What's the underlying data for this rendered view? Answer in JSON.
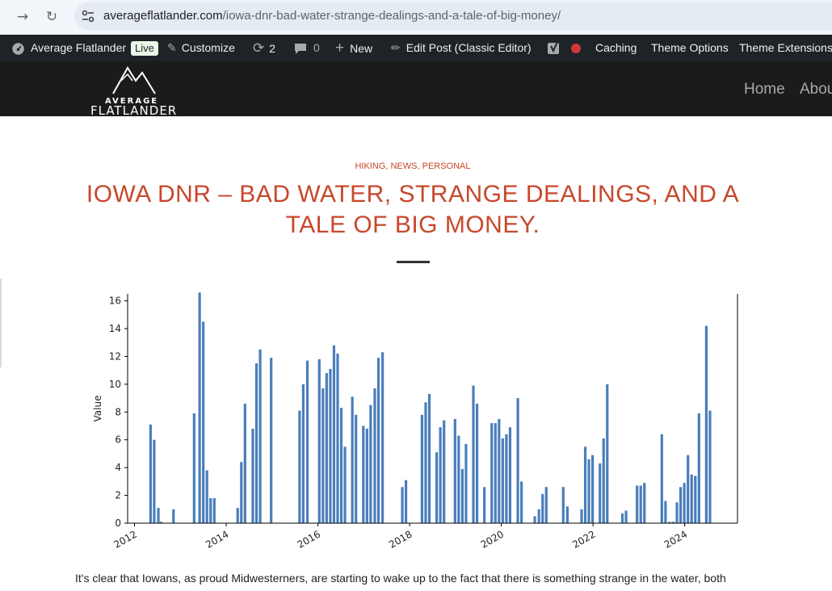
{
  "browser": {
    "url_domain": "averageflatlander.com",
    "url_path": "/iowa-dnr-bad-water-strange-dealings-and-a-tale-of-big-money/"
  },
  "adminbar": {
    "site_name": "Average Flatlander",
    "live_label": "Live",
    "customize": "Customize",
    "updates_count": "2",
    "comments_count": "0",
    "new_label": "New",
    "edit_post": "Edit Post (Classic Editor)",
    "caching": "Caching",
    "theme_options": "Theme Options",
    "theme_extensions": "Theme Extensions"
  },
  "site": {
    "logo_top": "AVERAGE",
    "logo_bottom": "FLATLANDER",
    "nav": [
      "Home",
      "About"
    ]
  },
  "article": {
    "categories": "Hiking, News, Personal",
    "title": "Iowa DNR – Bad Water, Strange Dealings, and a Tale of Big Money.",
    "body_excerpt": "It's clear that Iowans, as proud Midwesterners, are starting to wake up to the fact that there is something strange in the water, both physically and"
  },
  "colors": {
    "accent": "#c8472b",
    "bar": "#4a7ebb",
    "adminbar": "#1d2327",
    "header": "#1b1b1b"
  },
  "chart_data": {
    "type": "bar",
    "ylabel": "Value",
    "xlabel": "",
    "ylim": [
      0,
      16.5
    ],
    "xlim": [
      2011.85,
      2025.15
    ],
    "x_ticks": [
      "2012",
      "2014",
      "2016",
      "2018",
      "2020",
      "2022",
      "2024"
    ],
    "y_ticks": [
      "0",
      "2",
      "4",
      "6",
      "8",
      "10",
      "12",
      "14",
      "16"
    ],
    "bars": [
      [
        2012.35,
        7.1
      ],
      [
        2012.43,
        6.0
      ],
      [
        2012.52,
        1.1
      ],
      [
        2012.58,
        0.1
      ],
      [
        2012.85,
        1.0
      ],
      [
        2013.3,
        7.9
      ],
      [
        2013.42,
        16.6
      ],
      [
        2013.5,
        14.5
      ],
      [
        2013.58,
        3.8
      ],
      [
        2013.66,
        1.8
      ],
      [
        2013.74,
        1.8
      ],
      [
        2014.25,
        1.1
      ],
      [
        2014.33,
        4.4
      ],
      [
        2014.41,
        8.6
      ],
      [
        2014.58,
        6.8
      ],
      [
        2014.66,
        11.5
      ],
      [
        2014.74,
        12.5
      ],
      [
        2014.98,
        11.9
      ],
      [
        2015.6,
        8.1
      ],
      [
        2015.68,
        10.0
      ],
      [
        2015.77,
        11.7
      ],
      [
        2016.03,
        11.8
      ],
      [
        2016.11,
        9.7
      ],
      [
        2016.19,
        10.8
      ],
      [
        2016.27,
        11.1
      ],
      [
        2016.35,
        12.8
      ],
      [
        2016.43,
        12.2
      ],
      [
        2016.51,
        8.3
      ],
      [
        2016.59,
        5.5
      ],
      [
        2016.75,
        9.1
      ],
      [
        2016.83,
        7.8
      ],
      [
        2016.99,
        7.0
      ],
      [
        2017.07,
        6.8
      ],
      [
        2017.15,
        8.5
      ],
      [
        2017.24,
        9.7
      ],
      [
        2017.32,
        11.9
      ],
      [
        2017.41,
        12.3
      ],
      [
        2017.84,
        2.6
      ],
      [
        2017.92,
        3.1
      ],
      [
        2018.27,
        7.8
      ],
      [
        2018.35,
        8.7
      ],
      [
        2018.43,
        9.3
      ],
      [
        2018.59,
        5.1
      ],
      [
        2018.67,
        6.9
      ],
      [
        2018.75,
        7.4
      ],
      [
        2018.99,
        7.5
      ],
      [
        2019.07,
        6.3
      ],
      [
        2019.15,
        3.9
      ],
      [
        2019.23,
        5.7
      ],
      [
        2019.39,
        9.9
      ],
      [
        2019.47,
        8.6
      ],
      [
        2019.63,
        2.6
      ],
      [
        2019.79,
        7.2
      ],
      [
        2019.87,
        7.2
      ],
      [
        2019.95,
        7.5
      ],
      [
        2020.03,
        6.1
      ],
      [
        2020.11,
        6.4
      ],
      [
        2020.19,
        6.9
      ],
      [
        2020.36,
        9.0
      ],
      [
        2020.44,
        3.0
      ],
      [
        2020.73,
        0.5
      ],
      [
        2020.82,
        1.0
      ],
      [
        2020.9,
        2.1
      ],
      [
        2020.98,
        2.6
      ],
      [
        2021.35,
        2.6
      ],
      [
        2021.44,
        1.2
      ],
      [
        2021.75,
        1.0
      ],
      [
        2021.83,
        5.5
      ],
      [
        2021.91,
        4.6
      ],
      [
        2021.99,
        4.9
      ],
      [
        2022.15,
        4.3
      ],
      [
        2022.23,
        6.1
      ],
      [
        2022.31,
        10.0
      ],
      [
        2022.64,
        0.7
      ],
      [
        2022.72,
        0.9
      ],
      [
        2022.96,
        2.7
      ],
      [
        2023.04,
        2.7
      ],
      [
        2023.12,
        2.9
      ],
      [
        2023.5,
        6.4
      ],
      [
        2023.58,
        1.6
      ],
      [
        2023.67,
        0.1
      ],
      [
        2023.75,
        0.1
      ],
      [
        2023.83,
        1.5
      ],
      [
        2023.91,
        2.6
      ],
      [
        2023.99,
        2.9
      ],
      [
        2024.07,
        4.9
      ],
      [
        2024.15,
        3.5
      ],
      [
        2024.23,
        3.4
      ],
      [
        2024.31,
        7.9
      ],
      [
        2024.47,
        14.2
      ],
      [
        2024.55,
        8.1
      ]
    ]
  }
}
